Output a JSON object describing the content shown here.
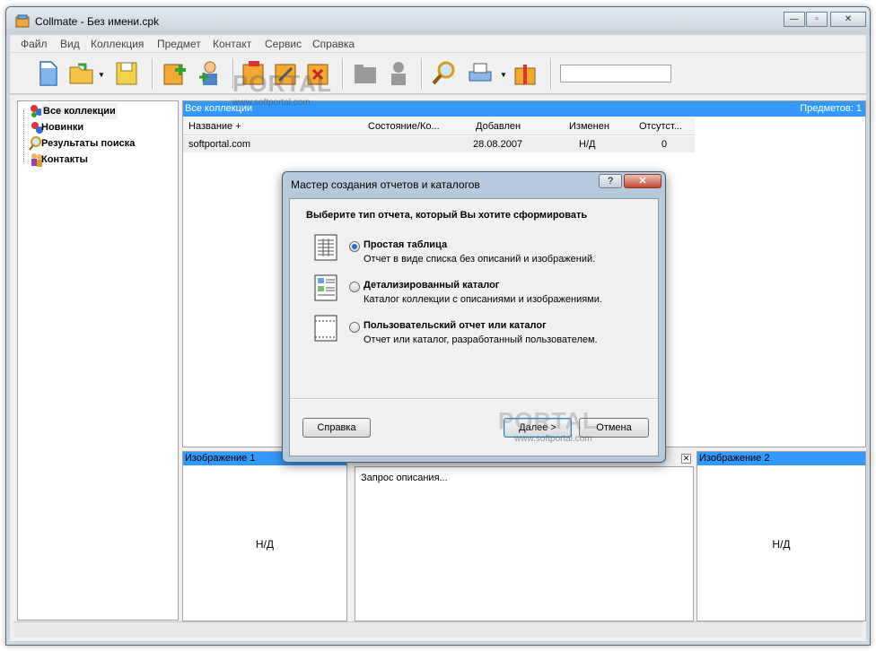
{
  "window": {
    "title": "Collmate - Без имени.cpk"
  },
  "menu": [
    "Файл",
    "Вид",
    "Коллекция",
    "Предмет",
    "Контакт",
    "Сервис",
    "Справка"
  ],
  "tree": {
    "items": [
      "Все коллекции",
      "Новинки",
      "Результаты поиска",
      "Контакты"
    ]
  },
  "main_panel": {
    "header": "Все коллекции",
    "count": "Предметов: 1",
    "columns": [
      "Название +",
      "Состояние/Ко...",
      "Добавлен",
      "Изменен",
      "Отсутст..."
    ],
    "rows": [
      {
        "name": "softportal.com",
        "state": "",
        "added": "28.08.2007",
        "changed": "Н/Д",
        "absent": "0"
      }
    ]
  },
  "image1": {
    "header": "Изображение 1",
    "value": "Н/Д"
  },
  "image2": {
    "header": "Изображение 2",
    "value": "Н/Д"
  },
  "description": {
    "text": "Запрос описания..."
  },
  "dialog": {
    "title": "Мастер создания отчетов и каталогов",
    "help_glyph": "?",
    "close_glyph": "✕",
    "heading": "Выберите тип отчета, который Вы хотите сформировать",
    "options": [
      {
        "label": "Простая таблица",
        "desc": "Отчет в виде списка без описаний и изображений.",
        "checked": true
      },
      {
        "label": "Детализированный каталог",
        "desc": "Каталог коллекции с описаниями и изображениями.",
        "checked": false
      },
      {
        "label": "Пользовательский отчет или каталог",
        "desc": "Отчет или каталог, разработанный пользователем.",
        "checked": false
      }
    ],
    "buttons": {
      "help": "Справка",
      "next": "Далее >",
      "cancel": "Отмена"
    }
  },
  "watermark": {
    "brand": "PORTAL",
    "url": "www.softportal.com"
  }
}
